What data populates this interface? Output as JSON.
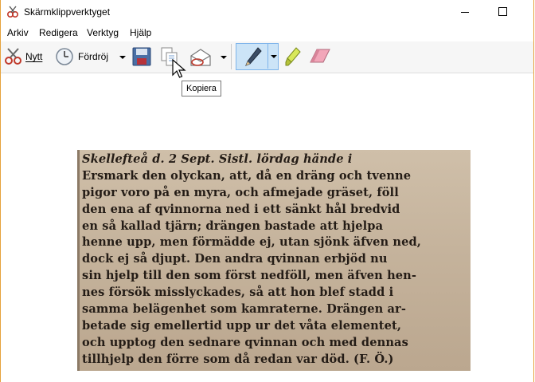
{
  "window": {
    "title": "Skärmklippverktyget"
  },
  "menu": {
    "items": [
      "Arkiv",
      "Redigera",
      "Verktyg",
      "Hjälp"
    ]
  },
  "toolbar": {
    "new_label": "Nytt",
    "delay_label": "Fördröj",
    "tooltip": "Kopiera"
  },
  "clip": {
    "lines": [
      "Skellefteå d. 2 Sept.   Sistl. lördag hände i",
      "Ersmark den olyckan, att, då en dräng och tvenne",
      "pigor voro på en myra, och afmejade gräset, föll",
      "den ena af qvinnorna ned i ett sänkt hål bredvid",
      "en så kallad tjärn; drängen bastade att hjelpa",
      "henne upp, men förmädde ej, utan sjönk äfven ned,",
      "dock ej så djupt.  Den andra qvinnan erbjöd nu",
      "sin hjelp till den som först nedföll, men äfven hen-",
      "nes försök misslyckades, så att hon blef stadd i",
      "samma belägenhet som kamraterne.  Drängen ar-",
      "betade sig emellertid upp ur det våta elementet,",
      "och upptog den sednare qvinnan och med dennas",
      "tillhjelp den förre som då redan var död.   (F. Ö.)"
    ]
  },
  "colors": {
    "accent_border": "#e6a23c",
    "selected_tool_bg": "#cce4f7",
    "clip_paper": "#c4b4a0"
  }
}
